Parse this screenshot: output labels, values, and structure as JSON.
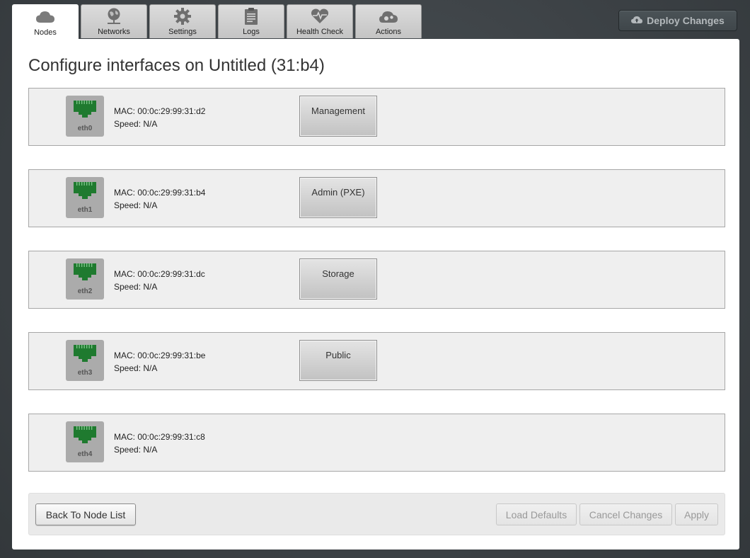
{
  "tabs": [
    {
      "label": "Nodes",
      "icon": "cloud-icon",
      "active": true
    },
    {
      "label": "Networks",
      "icon": "network-globe-icon",
      "active": false
    },
    {
      "label": "Settings",
      "icon": "gear-icon",
      "active": false
    },
    {
      "label": "Logs",
      "icon": "clipboard-icon",
      "active": false
    },
    {
      "label": "Health Check",
      "icon": "heart-pulse-icon",
      "active": false
    },
    {
      "label": "Actions",
      "icon": "cloud-gears-icon",
      "active": false
    }
  ],
  "deploy": {
    "label": "Deploy Changes",
    "icon": "cloud-upload-icon"
  },
  "page": {
    "title": "Configure interfaces on Untitled (31:b4)"
  },
  "interfaces": [
    {
      "name": "eth0",
      "mac": "MAC: 00:0c:29:99:31:d2",
      "speed": "Speed: N/A",
      "network": "Management"
    },
    {
      "name": "eth1",
      "mac": "MAC: 00:0c:29:99:31:b4",
      "speed": "Speed: N/A",
      "network": "Admin (PXE)"
    },
    {
      "name": "eth2",
      "mac": "MAC: 00:0c:29:99:31:dc",
      "speed": "Speed: N/A",
      "network": "Storage"
    },
    {
      "name": "eth3",
      "mac": "MAC: 00:0c:29:99:31:be",
      "speed": "Speed: N/A",
      "network": "Public"
    },
    {
      "name": "eth4",
      "mac": "MAC: 00:0c:29:99:31:c8",
      "speed": "Speed: N/A",
      "network": null
    }
  ],
  "footer": {
    "back": "Back To Node List",
    "load_defaults": "Load Defaults",
    "cancel": "Cancel Changes",
    "apply": "Apply"
  },
  "colors": {
    "port_green": "#1f7a2f",
    "port_bg": "#ababab"
  }
}
